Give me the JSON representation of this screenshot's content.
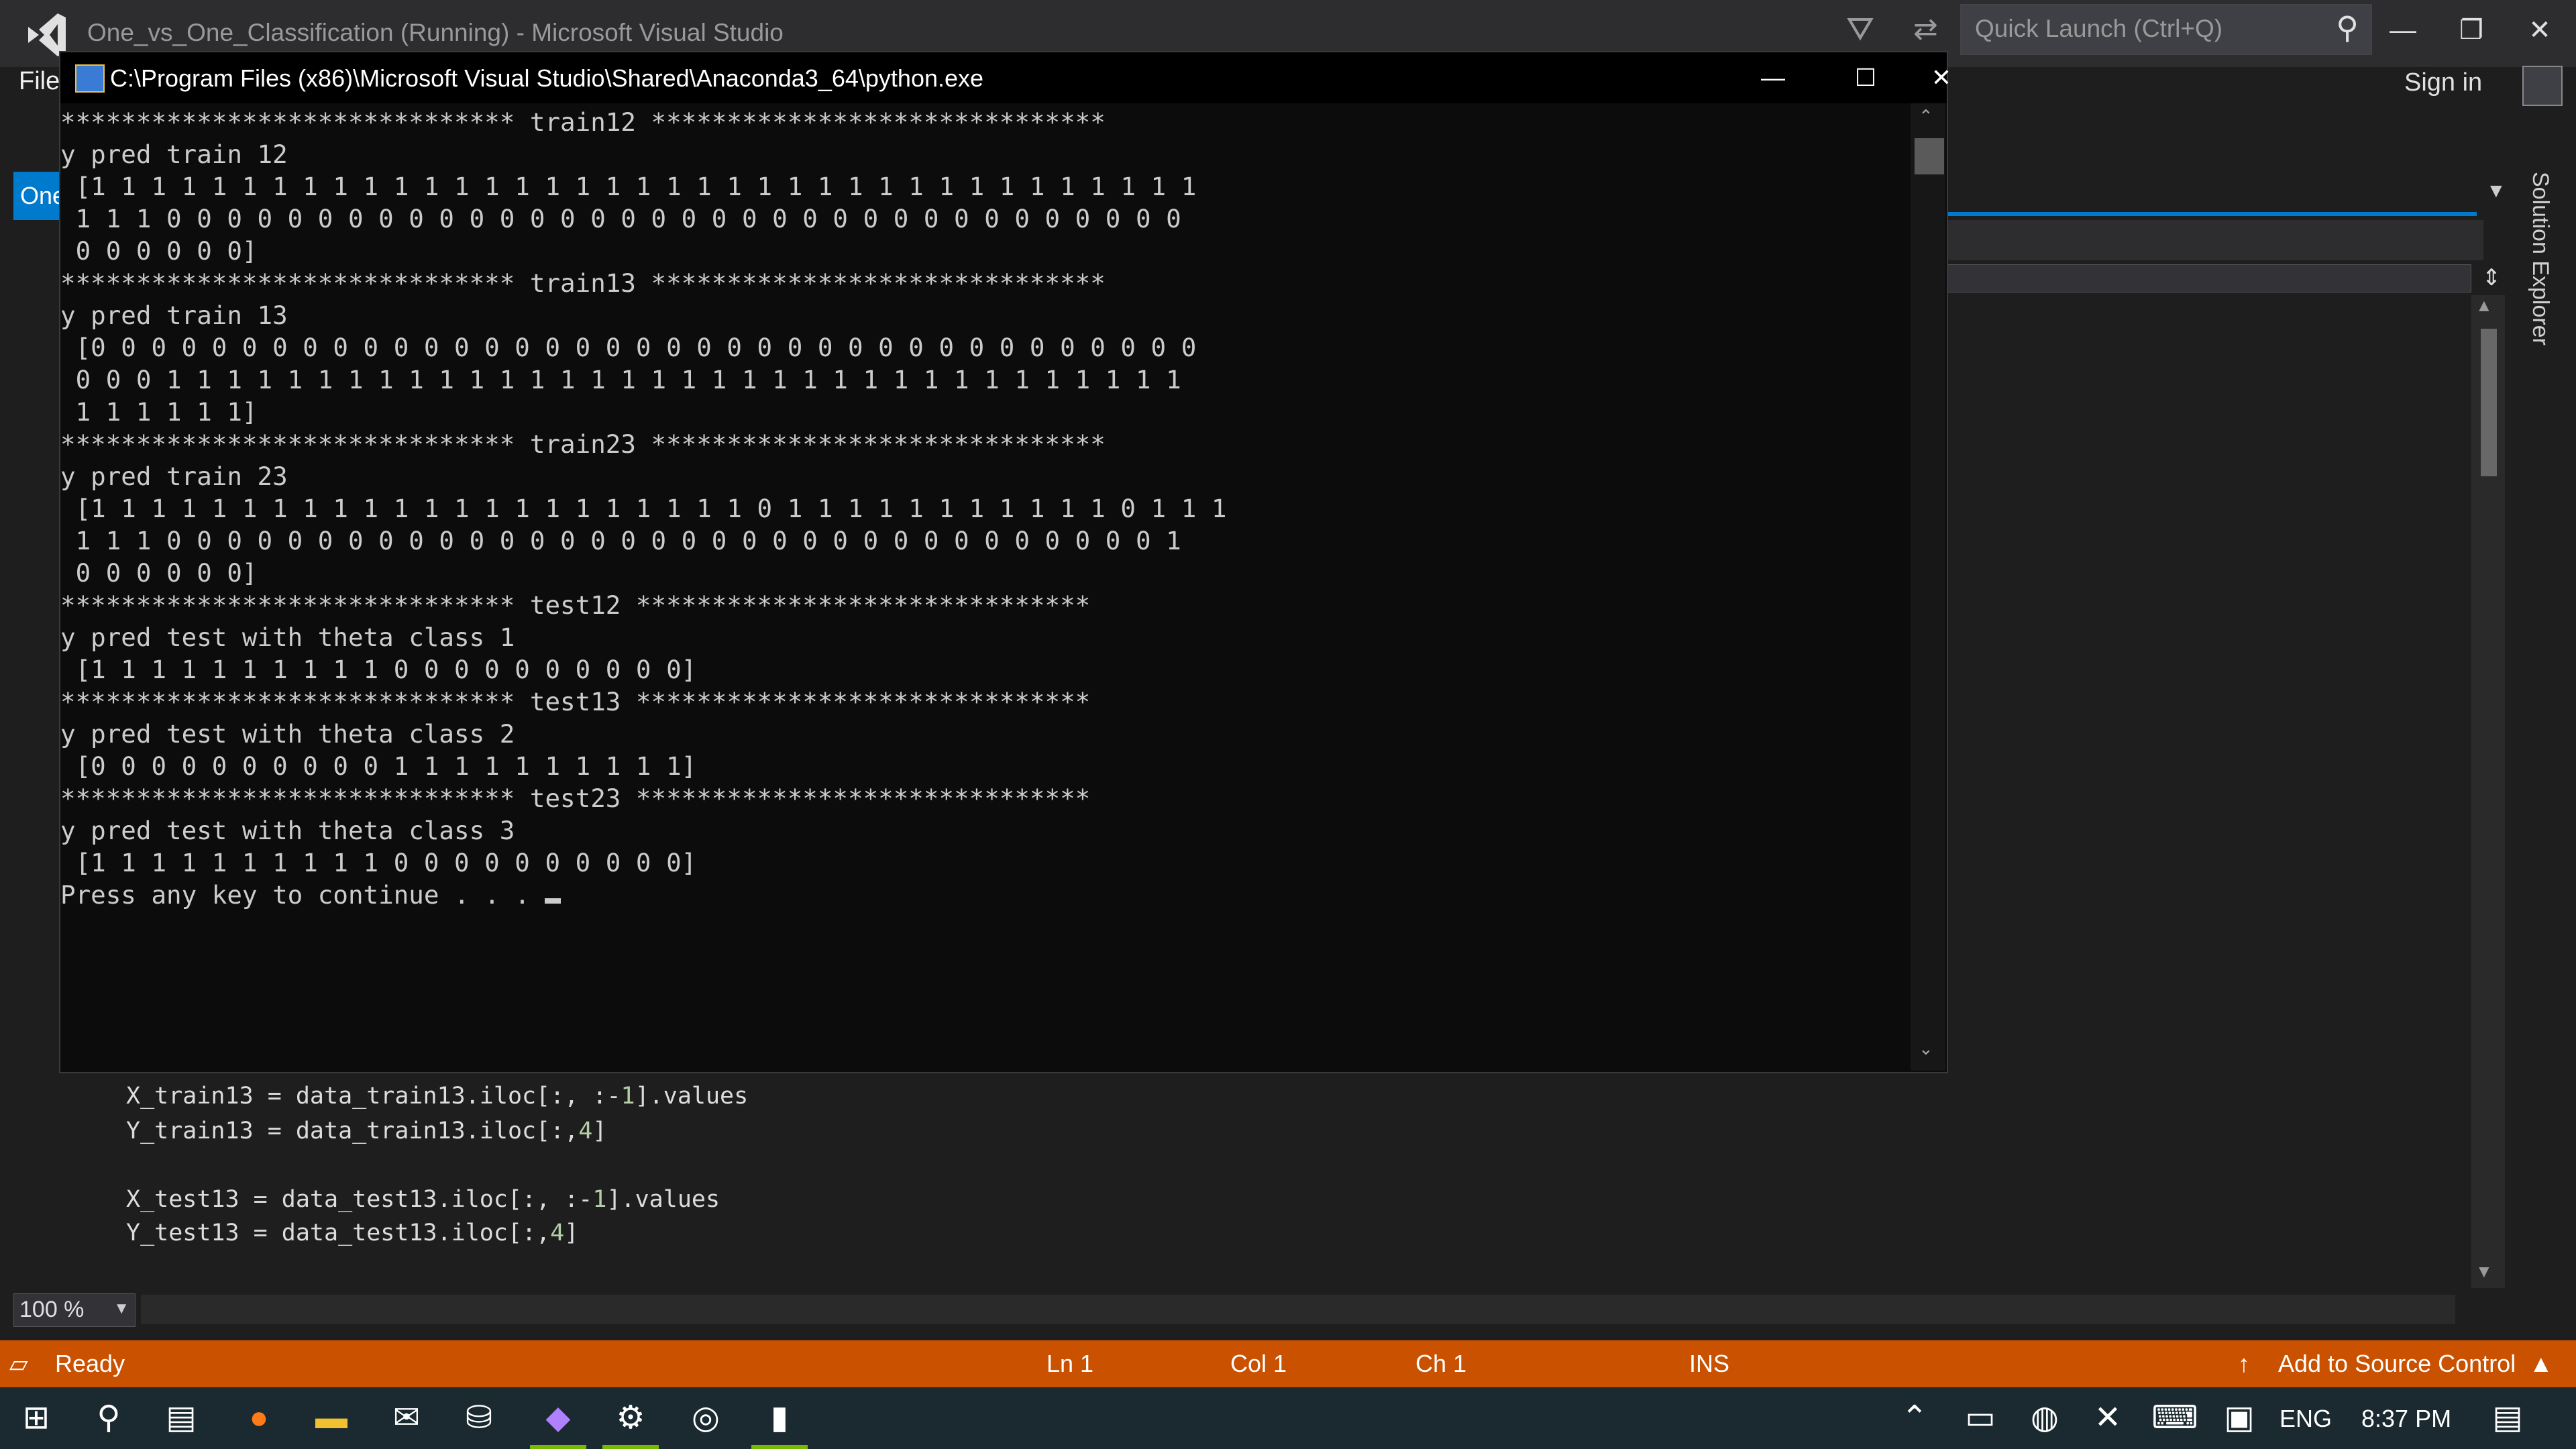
{
  "vs": {
    "window_title": "One_vs_One_Classification (Running) - Microsoft Visual Studio",
    "quick_launch_placeholder": "Quick Launch (Ctrl+Q)",
    "sign_in": "Sign in",
    "menu_file": "File",
    "left_tab_label": "One",
    "solution_explorer": "Solution Explorer",
    "zoom": "100 %",
    "code_lines": [
      "X_train13 = data_train13.iloc[:, :-1].values",
      "Y_train13 = data_train13.iloc[:,4]",
      "",
      "X_test13 = data_test13.iloc[:, :-1].values",
      "Y_test13 = data_test13.iloc[:,4]"
    ]
  },
  "console": {
    "title": "C:\\Program Files (x86)\\Microsoft Visual Studio\\Shared\\Anaconda3_64\\python.exe",
    "lines": [
      "****************************** train12 ******************************",
      "y pred train 12",
      " [1 1 1 1 1 1 1 1 1 1 1 1 1 1 1 1 1 1 1 1 1 1 1 1 1 1 1 1 1 1 1 1 1 1 1 1 1",
      " 1 1 1 0 0 0 0 0 0 0 0 0 0 0 0 0 0 0 0 0 0 0 0 0 0 0 0 0 0 0 0 0 0 0 0 0 0",
      " 0 0 0 0 0 0]",
      "****************************** train13 ******************************",
      "y pred train 13",
      " [0 0 0 0 0 0 0 0 0 0 0 0 0 0 0 0 0 0 0 0 0 0 0 0 0 0 0 0 0 0 0 0 0 0 0 0 0",
      " 0 0 0 1 1 1 1 1 1 1 1 1 1 1 1 1 1 1 1 1 1 1 1 1 1 1 1 1 1 1 1 1 1 1 1 1 1",
      " 1 1 1 1 1 1]",
      "****************************** train23 ******************************",
      "y pred train 23",
      " [1 1 1 1 1 1 1 1 1 1 1 1 1 1 1 1 1 1 1 1 1 1 0 1 1 1 1 1 1 1 1 1 1 1 0 1 1 1",
      " 1 1 1 0 0 0 0 0 0 0 0 0 0 0 0 0 0 0 0 0 0 0 0 0 0 0 0 0 0 0 0 0 0 0 0 0 1",
      " 0 0 0 0 0 0]",
      "****************************** test12 ******************************",
      "y pred test with theta class 1",
      " [1 1 1 1 1 1 1 1 1 1 0 0 0 0 0 0 0 0 0 0]",
      "****************************** test13 ******************************",
      "y pred test with theta class 2",
      " [0 0 0 0 0 0 0 0 0 0 1 1 1 1 1 1 1 1 1 1]",
      "****************************** test23 ******************************",
      "y pred test with theta class 3",
      " [1 1 1 1 1 1 1 1 1 1 0 0 0 0 0 0 0 0 0 0]",
      "Press any key to continue . . . "
    ]
  },
  "status": {
    "ready": "Ready",
    "ln": "Ln 1",
    "col": "Col 1",
    "ch": "Ch 1",
    "ins": "INS",
    "source_control": "Add to Source Control"
  },
  "taskbar": {
    "lang": "ENG",
    "time": "8:37 PM"
  },
  "colors": {
    "status_bar": "#ca5100",
    "accent": "#007acc"
  }
}
